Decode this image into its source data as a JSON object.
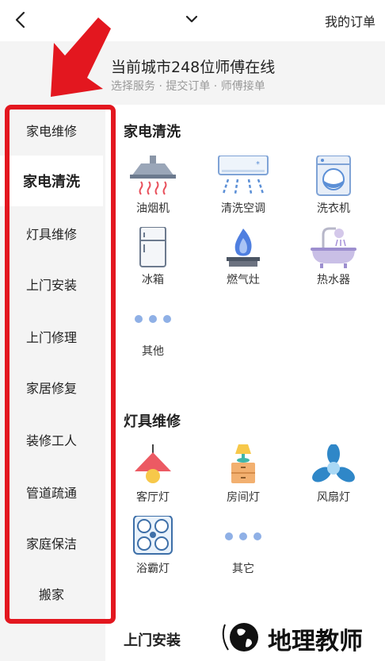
{
  "header": {
    "orders_label": "我的订单"
  },
  "banner": {
    "title": "当前城市248位师傅在线",
    "subtitle": "选择服务 · 提交订单 · 师傅接单"
  },
  "sidebar": {
    "items": [
      {
        "label": "家电维修",
        "active": false
      },
      {
        "label": "家电清洗",
        "active": true
      },
      {
        "label": "灯具维修",
        "active": false
      },
      {
        "label": "上门安装",
        "active": false
      },
      {
        "label": "上门修理",
        "active": false
      },
      {
        "label": "家居修复",
        "active": false
      },
      {
        "label": "装修工人",
        "active": false
      },
      {
        "label": "管道疏通",
        "active": false
      },
      {
        "label": "家庭保洁",
        "active": false
      },
      {
        "label": "搬家",
        "active": false
      }
    ]
  },
  "sections": [
    {
      "title": "家电清洗",
      "items": [
        {
          "label": "油烟机",
          "icon": "range-hood-icon"
        },
        {
          "label": "清洗空调",
          "icon": "air-conditioner-icon"
        },
        {
          "label": "洗衣机",
          "icon": "washing-machine-icon"
        },
        {
          "label": "冰箱",
          "icon": "refrigerator-icon"
        },
        {
          "label": "燃气灶",
          "icon": "gas-stove-icon"
        },
        {
          "label": "热水器",
          "icon": "water-heater-icon"
        },
        {
          "label": "其他",
          "icon": "more-dots-icon"
        }
      ]
    },
    {
      "title": "灯具维修",
      "items": [
        {
          "label": "客厅灯",
          "icon": "pendant-lamp-icon"
        },
        {
          "label": "房间灯",
          "icon": "bedside-lamp-icon"
        },
        {
          "label": "风扇灯",
          "icon": "fan-lamp-icon"
        },
        {
          "label": "浴霸灯",
          "icon": "bath-heater-icon"
        },
        {
          "label": "其它",
          "icon": "more-dots-icon"
        }
      ]
    },
    {
      "title": "上门安装",
      "items": []
    }
  ],
  "watermark": {
    "text": "地理教师"
  },
  "colors": {
    "annotation_red": "#e3171f",
    "sidebar_bg": "#f4f4f4",
    "icon_blue": "#5b8fd6"
  }
}
